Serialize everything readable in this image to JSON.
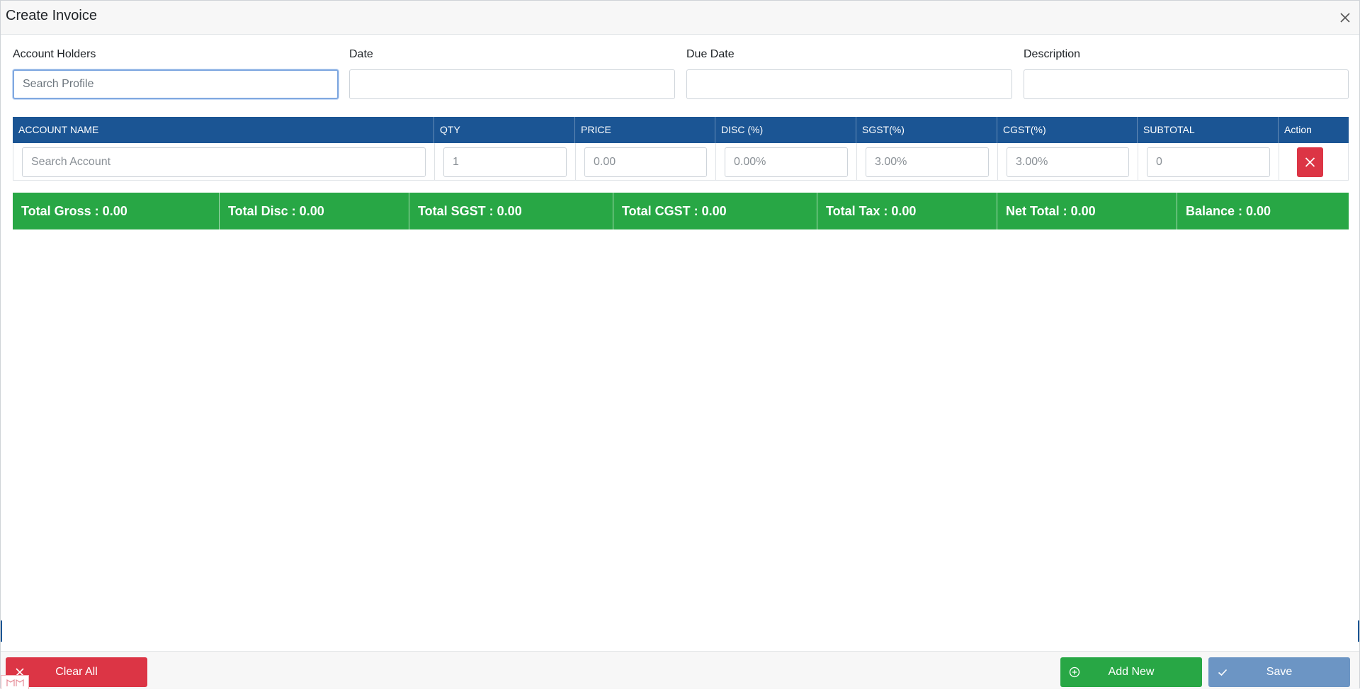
{
  "header": {
    "title": "Create Invoice"
  },
  "fields": {
    "account_holders": {
      "label": "Account Holders",
      "placeholder": "Search Profile",
      "value": ""
    },
    "date": {
      "label": "Date",
      "placeholder": "",
      "value": ""
    },
    "due_date": {
      "label": "Due Date",
      "placeholder": "",
      "value": ""
    },
    "description": {
      "label": "Description",
      "placeholder": "",
      "value": ""
    }
  },
  "grid": {
    "columns": [
      "ACCOUNT NAME",
      "QTY",
      "PRICE",
      "DISC (%)",
      "SGST(%)",
      "CGST(%)",
      "SUBTOTAL",
      "Action"
    ],
    "row": {
      "account_placeholder": "Search Account",
      "qty_placeholder": "1",
      "price_placeholder": "0.00",
      "disc_placeholder": "0.00%",
      "sgst_placeholder": "3.00%",
      "cgst_placeholder": "3.00%",
      "subtotal_placeholder": "0"
    }
  },
  "totals": {
    "gross": "Total Gross : 0.00",
    "disc": "Total Disc : 0.00",
    "sgst": "Total SGST : 0.00",
    "cgst": "Total CGST : 0.00",
    "tax": "Total Tax : 0.00",
    "net": "Net Total : 0.00",
    "balance": "Balance : 0.00"
  },
  "footer": {
    "clear_label": "Clear All",
    "add_label": "Add New",
    "save_label": "Save"
  },
  "icons": {
    "close": "close-icon",
    "delete_row": "close-icon",
    "clear": "close-icon",
    "add": "plus-circle-icon",
    "save": "check-icon"
  },
  "colors": {
    "grid_header": "#1b5594",
    "totals_bar": "#28a745",
    "danger": "#dc3545",
    "save": "#6c95c4"
  }
}
